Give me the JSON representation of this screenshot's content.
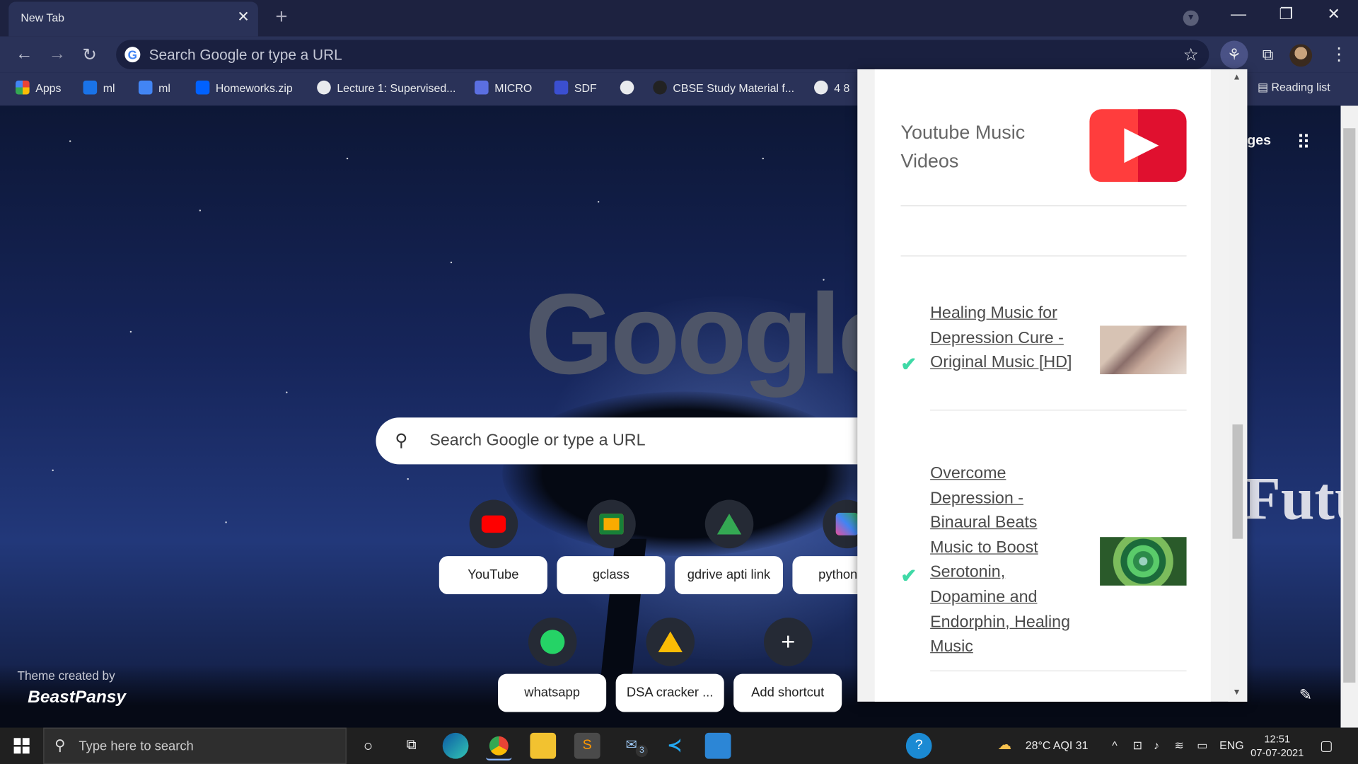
{
  "browser": {
    "tab_title": "New Tab",
    "tab_close": "✕",
    "new_tab": "+",
    "window_controls": {
      "minimize": "—",
      "restore": "❐",
      "close": "✕"
    }
  },
  "toolbar": {
    "back": "←",
    "forward": "→",
    "reload": "↻",
    "omnibox_placeholder": "Search Google or type a URL",
    "omnibox_g": "G",
    "star": "☆",
    "extension_active": "⚘",
    "extensions": "⧉",
    "menu": "⋮"
  },
  "bookmarks": {
    "items": [
      {
        "label": "Apps",
        "color": "#fbbc05"
      },
      {
        "label": "ml",
        "color": "#1a73e8"
      },
      {
        "label": "ml",
        "color": "#4285f4"
      },
      {
        "label": "Homeworks.zip",
        "color": "#0061ff"
      },
      {
        "label": "Lecture 1: Supervised...",
        "color": "#e8eaed"
      },
      {
        "label": "MICRO",
        "color": "#5b6fe0"
      },
      {
        "label": "SDF",
        "color": "#3b4fd0"
      },
      {
        "label": "",
        "color": "#e8eaed"
      },
      {
        "label": "CBSE Study Material f...",
        "color": "#222222"
      },
      {
        "label": "4 8",
        "color": "#e8eaed"
      }
    ],
    "reading_list": "Reading list"
  },
  "newtab": {
    "google_logo": "Google",
    "search_placeholder": "Search Google or type a URL",
    "top_right_text": "ges",
    "theme_credit": "Theme created by",
    "theme_brand": "BeastPansy",
    "background_word": "Future",
    "shortcuts": [
      {
        "label": "YouTube",
        "icon": "youtube-icon"
      },
      {
        "label": "gclass",
        "icon": "google-classroom-icon"
      },
      {
        "label": "gdrive apti link",
        "icon": "google-drive-icon"
      },
      {
        "label": "python co",
        "icon": "dj-icon"
      },
      {
        "label": "whatsapp",
        "icon": "whatsapp-icon"
      },
      {
        "label": "DSA cracker ...",
        "icon": "google-drive-icon"
      },
      {
        "label": "Add shortcut",
        "icon": "plus-icon"
      }
    ]
  },
  "popup": {
    "title": "Youtube Music Videos",
    "videos": [
      {
        "title": "Healing Music for Depression Cure - Original Music [HD]",
        "checked": true
      },
      {
        "title": "Overcome Depression - Binaural Beats Music to Boost Serotonin, Dopamine and Endorphin, Healing Music",
        "checked": true
      }
    ]
  },
  "taskbar": {
    "search_placeholder": "Type here to search",
    "weather": "28°C  AQI 31",
    "language": "ENG",
    "time": "12:51",
    "date": "07-07-2021",
    "mail_badge": "3"
  },
  "colors": {
    "accent": "#3fd9a6",
    "youtube_red": "#ff3d3d"
  }
}
